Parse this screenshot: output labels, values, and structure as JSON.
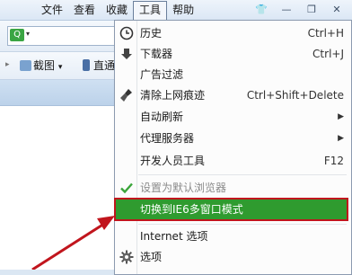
{
  "menubar": {
    "items": [
      "文件",
      "查看",
      "收藏",
      "工具",
      "帮助"
    ],
    "active_index": 3
  },
  "window_controls": {
    "shirt": "👕",
    "minimize": "—",
    "restore": "❐",
    "close": "✕"
  },
  "toolbar": {
    "screenshot_label": "截图",
    "direct_label": "直通",
    "screenshot_caret": "▾"
  },
  "colors": {
    "highlight_bg": "#2f9b2f",
    "callout_red": "#c1151d"
  },
  "dropdown": {
    "items": [
      {
        "label": "历史",
        "shortcut": "Ctrl+H",
        "icon": "clock-icon"
      },
      {
        "label": "下载器",
        "shortcut": "Ctrl+J",
        "icon": "download-arrow-icon"
      },
      {
        "label": "广告过滤",
        "shortcut": "",
        "icon": ""
      },
      {
        "label": "清除上网痕迹",
        "shortcut": "Ctrl+Shift+Delete",
        "icon": "broom-icon"
      },
      {
        "label": "自动刷新",
        "shortcut": "",
        "submenu": true
      },
      {
        "label": "代理服务器",
        "shortcut": "",
        "submenu": true
      },
      {
        "label": "开发人员工具",
        "shortcut": "F12"
      },
      {
        "label": "设置为默认浏览器",
        "disabled": true,
        "icon": "checkmark-icon"
      },
      {
        "label": "切换到IE6多窗口模式",
        "highlighted": true
      },
      {
        "label": "Internet 选项"
      },
      {
        "label": "选项",
        "icon": "gear-icon"
      }
    ],
    "submenu_arrow": "▶"
  }
}
